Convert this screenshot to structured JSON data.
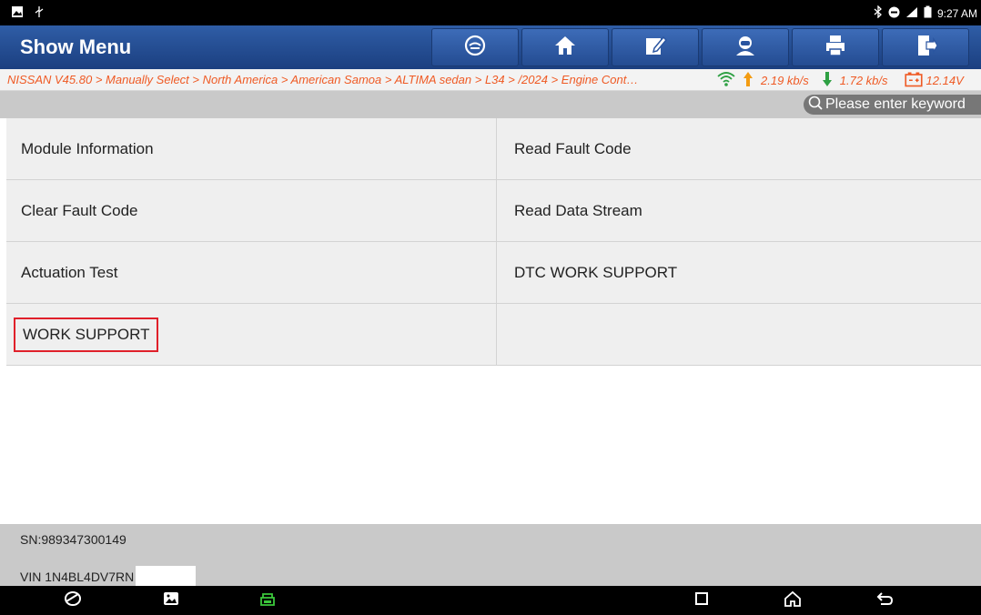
{
  "status_bar": {
    "time": "9:27 AM",
    "icons": [
      "image-icon",
      "usb-icon",
      "bluetooth-icon",
      "dnd-icon",
      "signal-icon",
      "battery-icon"
    ]
  },
  "header": {
    "title": "Show Menu",
    "toolbar": [
      "vehicle-icon",
      "home-icon",
      "edit-icon",
      "support-icon",
      "print-icon",
      "exit-icon"
    ]
  },
  "breadcrumb": {
    "path": "NISSAN V45.80 > Manually Select > North America > American Samoa > ALTIMA sedan > L34 > /2024 > Engine Cont…",
    "upload_speed": "2.19 kb/s",
    "download_speed": "1.72 kb/s",
    "voltage": "12.14V"
  },
  "search": {
    "placeholder": "Please enter keyword"
  },
  "menu": {
    "rows": [
      {
        "left": "Module Information",
        "right": "Read Fault Code"
      },
      {
        "left": "Clear Fault Code",
        "right": "Read Data Stream"
      },
      {
        "left": "Actuation Test",
        "right": "DTC WORK SUPPORT"
      },
      {
        "left": "WORK SUPPORT",
        "right": ""
      }
    ]
  },
  "footer": {
    "sn": "SN:989347300149",
    "vin": "VIN 1N4BL4DV7RN"
  },
  "colors": {
    "header_blue": "#2f5da6",
    "breadcrumb_orange": "#ef5a24",
    "highlight_red": "#e0202a",
    "upload_arrow": "#f39c12",
    "download_arrow": "#2ea043",
    "vci_green": "#3cc83c"
  },
  "nav_bar": {
    "icons": [
      "browser-icon",
      "gallery-icon",
      "vci-icon",
      "recents-icon",
      "home-nav-icon",
      "back-icon"
    ]
  }
}
